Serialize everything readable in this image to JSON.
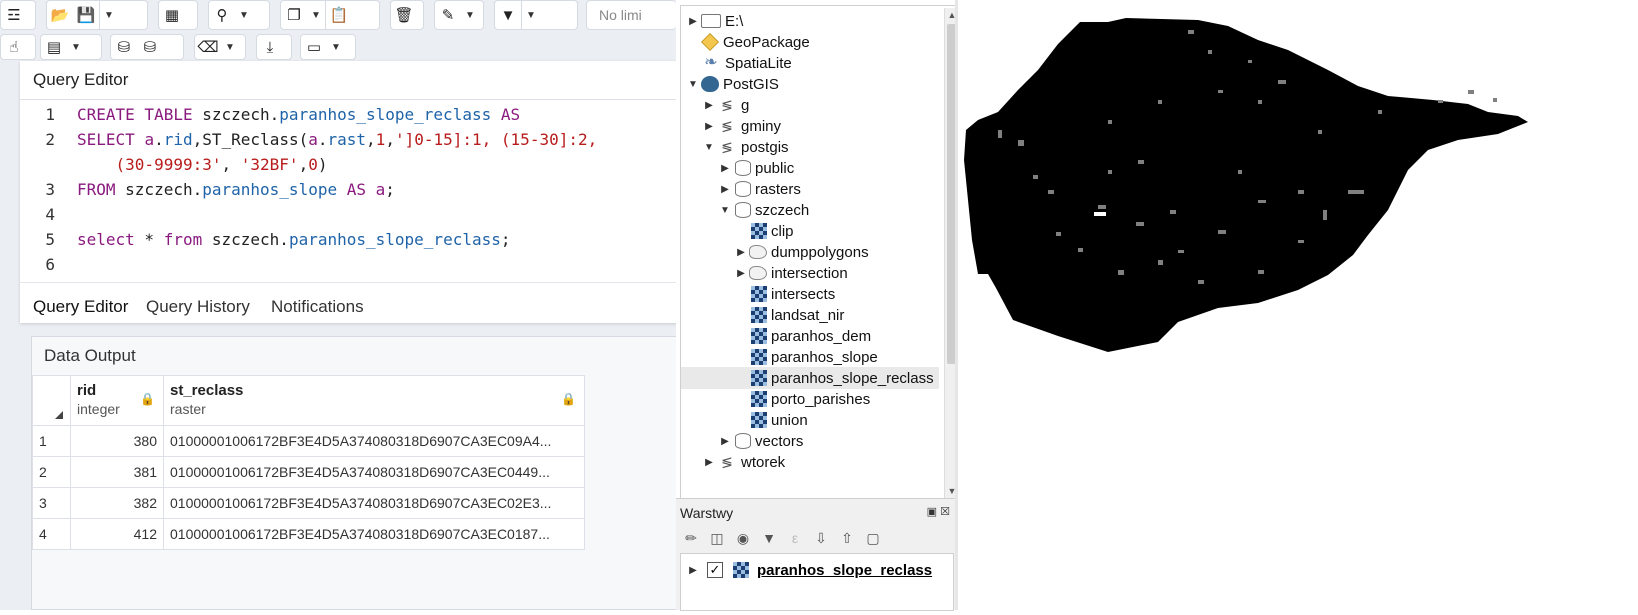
{
  "pgadmin": {
    "toolbar": {
      "limit_text": "No limi"
    },
    "query_editor": {
      "title": "Query Editor",
      "line_numbers": [
        "1",
        "2",
        "3",
        "4",
        "5",
        "6"
      ],
      "tabs": [
        "Query Editor",
        "Query History",
        "Notifications"
      ]
    },
    "data_output": {
      "title": "Data Output",
      "columns": [
        {
          "name": "rid",
          "type": "integer"
        },
        {
          "name": "st_reclass",
          "type": "raster"
        }
      ],
      "rows": [
        {
          "idx": "1",
          "rid": "380",
          "st_reclass": "01000001006172BF3E4D5A374080318D6907CA3EC09A4..."
        },
        {
          "idx": "2",
          "rid": "381",
          "st_reclass": "01000001006172BF3E4D5A374080318D6907CA3EC0449..."
        },
        {
          "idx": "3",
          "rid": "382",
          "st_reclass": "01000001006172BF3E4D5A374080318D6907CA3EC02E3..."
        },
        {
          "idx": "4",
          "rid": "412",
          "st_reclass": "01000001006172BF3E4D5A374080318D6907CA3EC0187..."
        }
      ]
    }
  },
  "qgis": {
    "browser": {
      "items": [
        {
          "label": "E:\\",
          "icon": "folder-icon"
        },
        {
          "label": "GeoPackage",
          "icon": "geopackage-icon"
        },
        {
          "label": "SpatiaLite",
          "icon": "spatialite-icon"
        },
        {
          "label": "PostGIS",
          "icon": "postgis-icon"
        },
        {
          "label": "g",
          "icon": "connection-icon"
        },
        {
          "label": "gminy",
          "icon": "connection-icon"
        },
        {
          "label": "postgis",
          "icon": "connection-icon"
        },
        {
          "label": "public",
          "icon": "schema-icon"
        },
        {
          "label": "rasters",
          "icon": "schema-icon"
        },
        {
          "label": "szczech",
          "icon": "schema-icon"
        },
        {
          "label": "clip",
          "icon": "raster-icon"
        },
        {
          "label": "dumppolygons",
          "icon": "polygon-icon"
        },
        {
          "label": "intersection",
          "icon": "polygon-icon"
        },
        {
          "label": "intersects",
          "icon": "raster-icon"
        },
        {
          "label": "landsat_nir",
          "icon": "raster-icon"
        },
        {
          "label": "paranhos_dem",
          "icon": "raster-icon"
        },
        {
          "label": "paranhos_slope",
          "icon": "raster-icon"
        },
        {
          "label": "paranhos_slope_reclass",
          "icon": "raster-icon"
        },
        {
          "label": "porto_parishes",
          "icon": "raster-icon"
        },
        {
          "label": "union",
          "icon": "raster-icon"
        },
        {
          "label": "vectors",
          "icon": "schema-icon"
        },
        {
          "label": "wtorek",
          "icon": "connection-icon"
        }
      ]
    },
    "layers_panel": {
      "title": "Warstwy",
      "layer_name": "paranhos_slope_reclass",
      "layer_checked": true
    },
    "map": {
      "fill_color": "#000000",
      "speckle_color": "#808080"
    }
  }
}
